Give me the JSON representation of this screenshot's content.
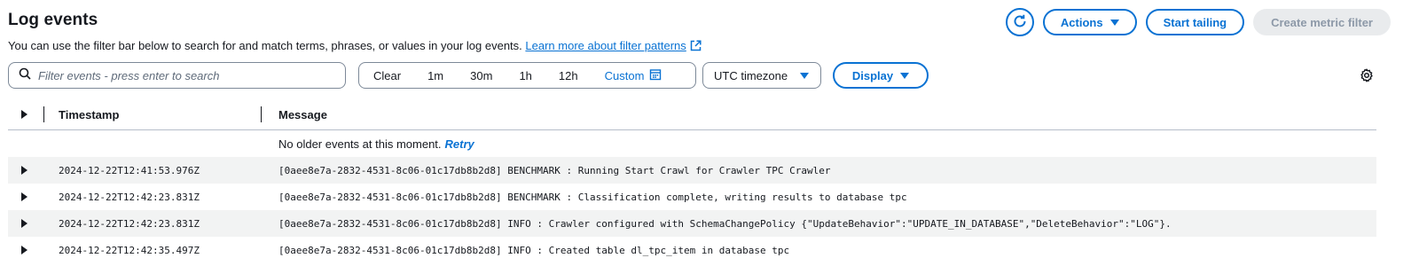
{
  "header": {
    "title": "Log events",
    "description": "You can use the filter bar below to search for and match terms, phrases, or values in your log events.",
    "learn_more_link": "Learn more about filter patterns",
    "actions_label": "Actions",
    "start_tailing_label": "Start tailing",
    "create_metric_filter_label": "Create metric filter"
  },
  "filter": {
    "search_placeholder": "Filter events - press enter to search",
    "search_value": "",
    "time_ranges": [
      "Clear",
      "1m",
      "30m",
      "1h",
      "12h"
    ],
    "custom_label": "Custom",
    "timezone_label": "UTC timezone",
    "display_label": "Display"
  },
  "table": {
    "columns": [
      "Timestamp",
      "Message"
    ],
    "no_older_text": "No older events at this moment.",
    "retry_label": "Retry",
    "rows": [
      {
        "timestamp": "2024-12-22T12:41:53.976Z",
        "message": "[0aee8e7a-2832-4531-8c06-01c17db8b2d8] BENCHMARK : Running Start Crawl for Crawler TPC Crawler"
      },
      {
        "timestamp": "2024-12-22T12:42:23.831Z",
        "message": "[0aee8e7a-2832-4531-8c06-01c17db8b2d8] BENCHMARK : Classification complete, writing results to database tpc"
      },
      {
        "timestamp": "2024-12-22T12:42:23.831Z",
        "message": "[0aee8e7a-2832-4531-8c06-01c17db8b2d8] INFO : Crawler configured with SchemaChangePolicy {\"UpdateBehavior\":\"UPDATE_IN_DATABASE\",\"DeleteBehavior\":\"LOG\"}."
      },
      {
        "timestamp": "2024-12-22T12:42:35.497Z",
        "message": "[0aee8e7a-2832-4531-8c06-01c17db8b2d8] INFO : Created table dl_tpc_item in database tpc"
      }
    ]
  },
  "colors": {
    "accent": "#0972d3",
    "text": "#16191f",
    "disabled_bg": "#e9ebed",
    "disabled_text": "#8d99a8",
    "row_stripe": "#f2f3f3"
  },
  "icons": [
    "refresh-icon",
    "caret-down-icon",
    "external-link-icon",
    "search-icon",
    "calendar-icon",
    "gear-icon",
    "expand-icon"
  ]
}
